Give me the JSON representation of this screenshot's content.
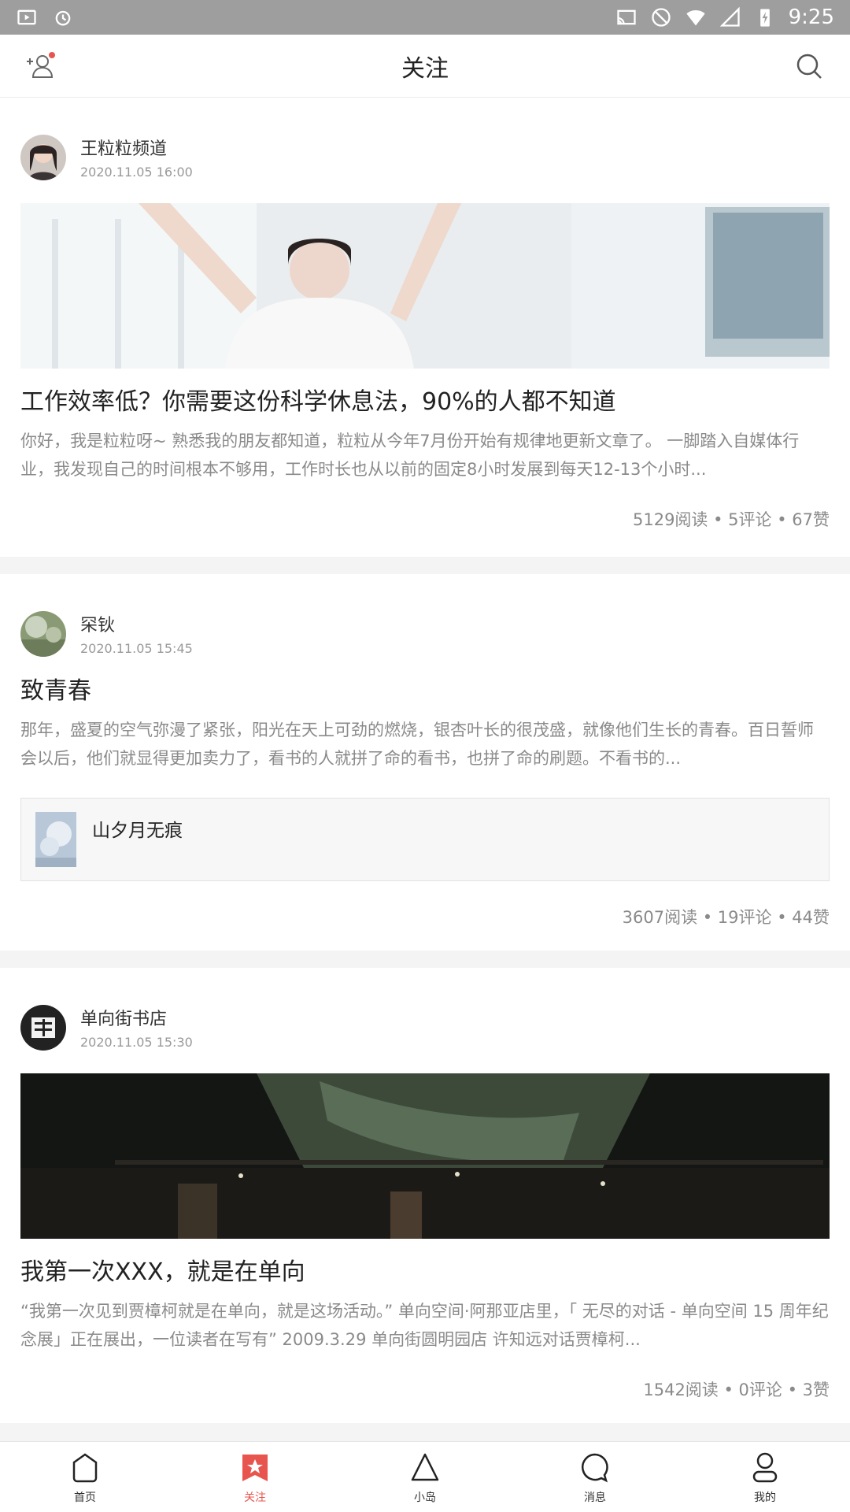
{
  "status_bar": {
    "time": "9:25"
  },
  "header": {
    "title": "关注"
  },
  "posts": [
    {
      "author": "王粒粒频道",
      "time": "2020.11.05 16:00",
      "title": "工作效率低？你需要这份科学休息法，90%的人都不知道",
      "excerpt": "你好，我是粒粒呀~ 熟悉我的朋友都知道，粒粒从今年7月份开始有规律地更新文章了。 一脚踏入自媒体行业，我发现自己的时间根本不够用，工作时长也从以前的固定8小时发展到每天12-13个小时...",
      "stats": "5129阅读 • 5评论 • 67赞"
    },
    {
      "author": "罙钬",
      "time": "2020.11.05 15:45",
      "title": "致青春",
      "excerpt": "那年，盛夏的空气弥漫了紧张，阳光在天上可劲的燃烧，银杏叶长的很茂盛，就像他们生长的青春。百日誓师会以后，他们就显得更加卖力了，看书的人就拼了命的看书，也拼了命的刷题。不看书的...",
      "quote": "山夕月无痕",
      "stats": "3607阅读 • 19评论 • 44赞"
    },
    {
      "author": "单向街书店",
      "time": "2020.11.05 15:30",
      "title": "我第一次XXX，就是在单向",
      "excerpt": "“我第一次见到贾樟柯就是在单向，就是这场活动。” 单向空间·阿那亚店里，「 无尽的对话 - 单向空间 15 周年纪念展」正在展出，一位读者在写有” 2009.3.29 单向街圆明园店 许知远对话贾樟柯...",
      "stats": "1542阅读 • 0评论 • 3赞"
    }
  ],
  "tabs": [
    {
      "label": "首页",
      "icon": "home-icon"
    },
    {
      "label": "关注",
      "icon": "follow-star-icon"
    },
    {
      "label": "小岛",
      "icon": "island-icon"
    },
    {
      "label": "消息",
      "icon": "message-icon"
    },
    {
      "label": "我的",
      "icon": "profile-icon"
    }
  ],
  "colors": {
    "accent": "#e8554e",
    "status_bar": "#9e9e9e"
  }
}
